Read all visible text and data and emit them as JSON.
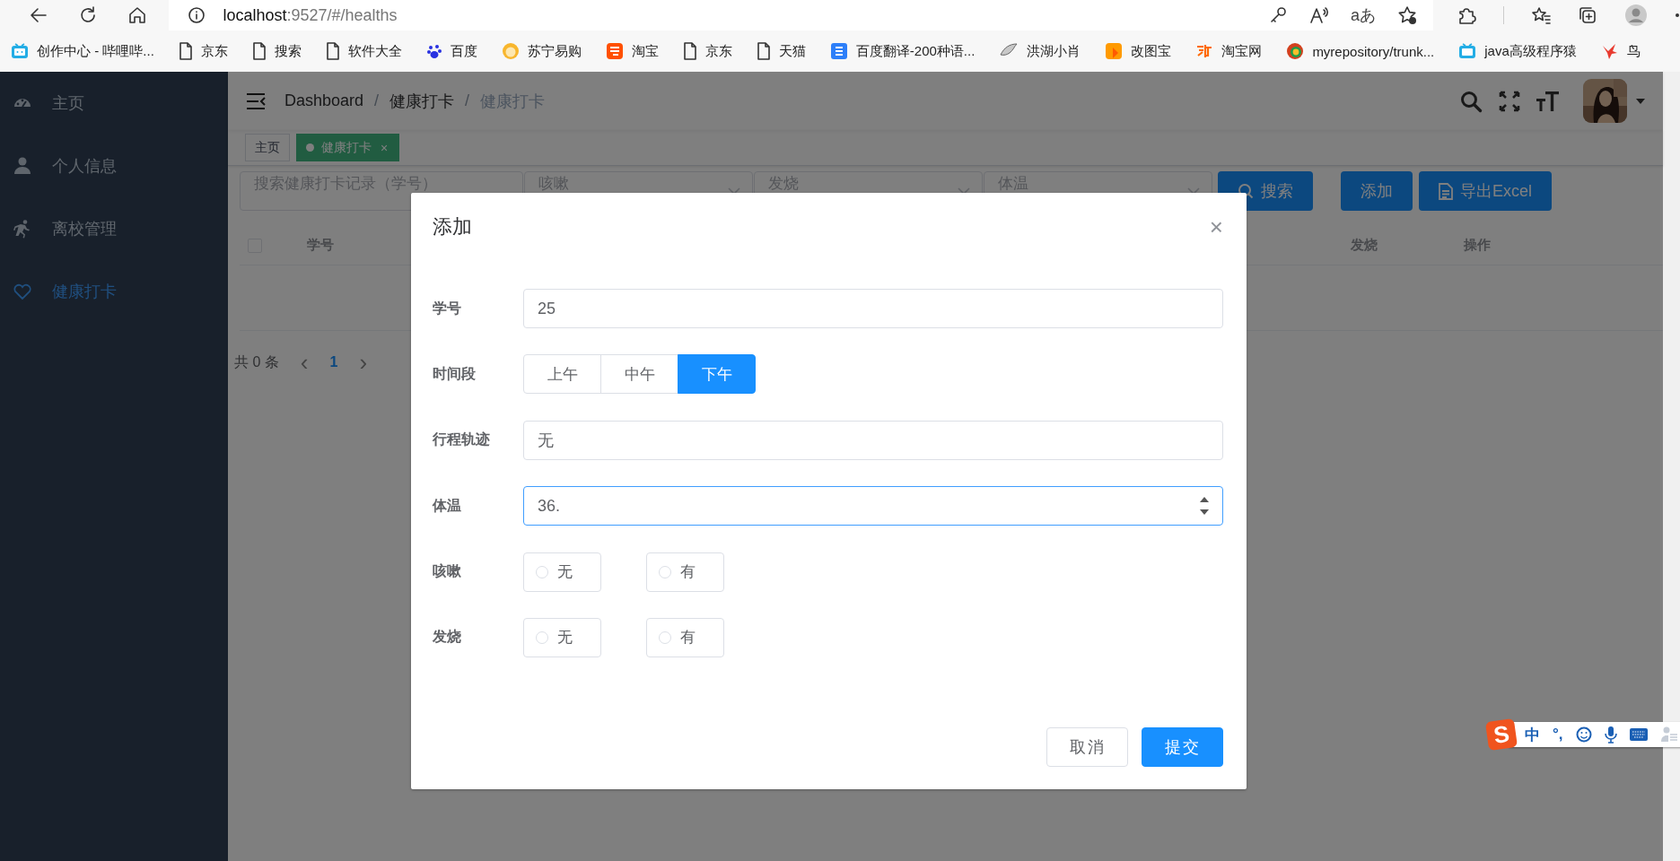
{
  "browser": {
    "url_host": "localhost",
    "url_path": ":9527/#/healths",
    "translate_glyph": "aあ",
    "bookmarks": [
      {
        "label": "创作中心 - 哔哩哔..."
      },
      {
        "label": "京东"
      },
      {
        "label": "搜索"
      },
      {
        "label": "软件大全"
      },
      {
        "label": "百度"
      },
      {
        "label": "苏宁易购"
      },
      {
        "label": "淘宝"
      },
      {
        "label": "京东"
      },
      {
        "label": "天猫"
      },
      {
        "label": "百度翻译-200种语..."
      },
      {
        "label": "洪湖小肖"
      },
      {
        "label": "改图宝"
      },
      {
        "label": "淘宝网"
      },
      {
        "label": "myrepository/trunk..."
      },
      {
        "label": "java高级程序猿"
      },
      {
        "label": "鸟"
      }
    ]
  },
  "sidebar": {
    "items": [
      {
        "label": "主页",
        "selected": false
      },
      {
        "label": "个人信息",
        "selected": false
      },
      {
        "label": "离校管理",
        "selected": false
      },
      {
        "label": "健康打卡",
        "selected": true
      }
    ]
  },
  "header": {
    "breadcrumb": [
      "Dashboard",
      "健康打卡",
      "健康打卡"
    ],
    "separator": "/"
  },
  "tags": [
    {
      "label": "主页",
      "selected": false
    },
    {
      "label": "健康打卡",
      "selected": true,
      "close": "×"
    }
  ],
  "filters": {
    "search_placeholder": "搜索健康打卡记录（学号）",
    "selects": [
      {
        "placeholder": "咳嗽"
      },
      {
        "placeholder": "发烧"
      },
      {
        "placeholder": "体温"
      }
    ],
    "buttons": [
      {
        "label": "搜索",
        "kind": "search"
      },
      {
        "label": "添加",
        "kind": "plain"
      },
      {
        "label": "导出Excel",
        "kind": "export"
      }
    ]
  },
  "table": {
    "columns": [
      {
        "label": "学号"
      },
      {
        "label": "发烧"
      },
      {
        "label": "操作"
      }
    ],
    "select_all": false
  },
  "pagination": {
    "total": "共 0 条",
    "prev": "‹",
    "page": "1",
    "next": "›"
  },
  "dialog": {
    "title": "添加",
    "close": "×",
    "fields": [
      {
        "kind": "text",
        "label": "学号",
        "value": "25"
      },
      {
        "kind": "segmented",
        "label": "时间段",
        "options": [
          {
            "label": "上午",
            "selected": false
          },
          {
            "label": "中午",
            "selected": false
          },
          {
            "label": "下午",
            "selected": true
          }
        ]
      },
      {
        "kind": "text",
        "label": "行程轨迹",
        "value": "无"
      },
      {
        "kind": "number",
        "label": "体温",
        "value": "36.",
        "focused": true
      },
      {
        "kind": "radio",
        "label": "咳嗽",
        "options": [
          {
            "label": "无",
            "selected": false
          },
          {
            "label": "有",
            "selected": false
          }
        ]
      },
      {
        "kind": "radio",
        "label": "发烧",
        "options": [
          {
            "label": "无",
            "selected": false
          },
          {
            "label": "有",
            "selected": false
          }
        ]
      }
    ],
    "buttons": [
      {
        "label": "取消",
        "primary": false
      },
      {
        "label": "提交",
        "primary": true
      }
    ]
  },
  "ime": {
    "logo": "S",
    "mode": "中",
    "punct": "°,"
  }
}
